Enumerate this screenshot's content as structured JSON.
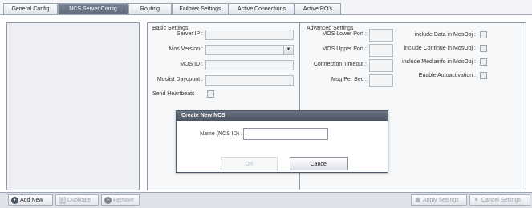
{
  "tabs": [
    {
      "label": "General Config",
      "active": false
    },
    {
      "label": "NCS Server Config",
      "active": true
    },
    {
      "label": "Routing",
      "active": false
    },
    {
      "label": "Failover Settings",
      "active": false
    },
    {
      "label": "Active Connections",
      "active": false
    },
    {
      "label": "Active RO's",
      "active": false
    }
  ],
  "basic": {
    "section_title": "Basic Settings",
    "server_ip_label": "Server IP :",
    "server_ip_value": "",
    "mos_version_label": "Mos Version :",
    "mos_version_value": "",
    "mos_id_label": "MOS ID :",
    "mos_id_value": "",
    "moslist_daycount_label": "Moslist Daycount :",
    "moslist_daycount_value": "",
    "send_heartbeats_label": "Send Heartbeats :",
    "send_heartbeats_checked": false
  },
  "advanced": {
    "section_title": "Advanced Settings",
    "mos_lower_port_label": "MOS Lower Port :",
    "mos_upper_port_label": "MOS Upper Port :",
    "connection_timeout_label": "Connection Timeout :",
    "msg_per_sec_label": "Msg Per Sec :",
    "include_data_label": "include Data in MosObj :",
    "include_continue_label": "include Continue in MosObj :",
    "include_mediainfo_label": "include Mediainfo in MosObj :",
    "enable_autoactivation_label": "Enable Autoactivation :"
  },
  "left_toolbar": {
    "add_new": "Add New",
    "duplicate": "Duplicate",
    "remove": "Remove"
  },
  "right_toolbar": {
    "apply": "Apply Settings",
    "cancel": "Cancel Settings"
  },
  "dialog": {
    "title": "Create New NCS",
    "name_label": "Name (NCS ID) :",
    "name_value": "",
    "ok": "OK",
    "cancel": "Cancel"
  }
}
